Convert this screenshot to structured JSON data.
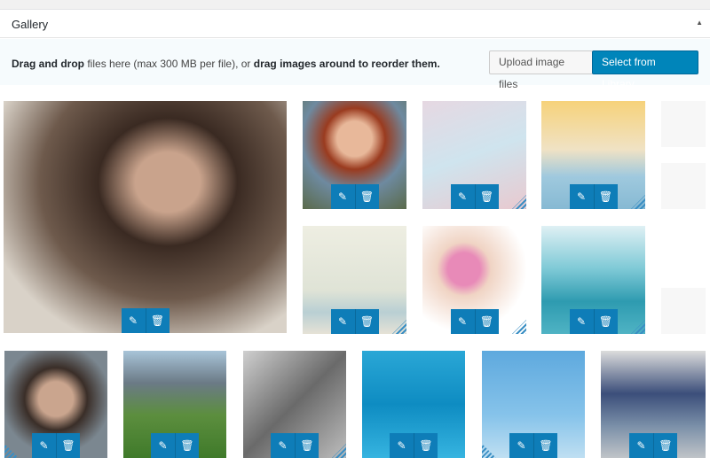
{
  "header": {
    "title": "Gallery",
    "toggle": "▲"
  },
  "bar": {
    "msg_bold1": "Drag and drop",
    "msg_mid": " files here (max 300 MB per file), or ",
    "msg_bold2": "drag images around to reorder them."
  },
  "buttons": {
    "upload": "Upload image files",
    "library": "Select from Library"
  },
  "icons": {
    "edit": "✎",
    "delete": "🗑"
  },
  "colors": {
    "accent": "#0085ba",
    "action": "#0e7db8"
  }
}
